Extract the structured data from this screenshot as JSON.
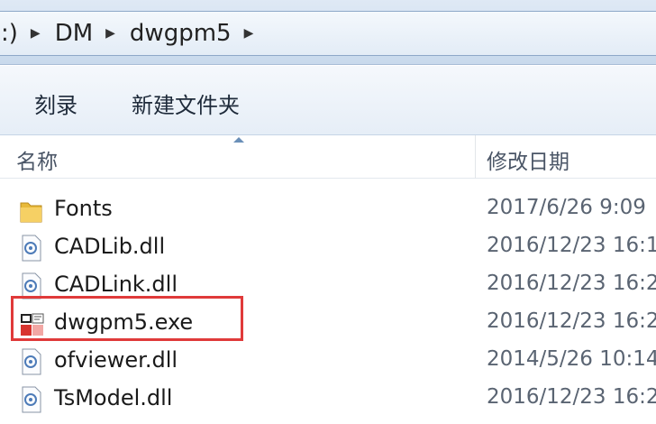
{
  "address": {
    "crumbs": [
      {
        "label": ":)"
      },
      {
        "label": "DM"
      },
      {
        "label": "dwgpm5"
      }
    ]
  },
  "toolbar": {
    "burn_label": "刻录",
    "new_folder_label": "新建文件夹"
  },
  "columns": {
    "name": "名称",
    "modified": "修改日期"
  },
  "files": [
    {
      "name": "Fonts",
      "date": "2017/6/26 9:09",
      "icon": "folder-icon"
    },
    {
      "name": "CADLib.dll",
      "date": "2016/12/23 16:1",
      "icon": "dll-file-icon"
    },
    {
      "name": "CADLink.dll",
      "date": "2016/12/23 16:2",
      "icon": "dll-file-icon"
    },
    {
      "name": "dwgpm5.exe",
      "date": "2016/12/23 16:2",
      "icon": "exe-app-icon"
    },
    {
      "name": "ofviewer.dll",
      "date": "2014/5/26 10:14",
      "icon": "dll-file-icon"
    },
    {
      "name": "TsModel.dll",
      "date": "2016/12/23 16:2",
      "icon": "dll-file-icon"
    }
  ],
  "colors": {
    "highlight": "#e03a3a",
    "folder": "#e8b93a"
  }
}
